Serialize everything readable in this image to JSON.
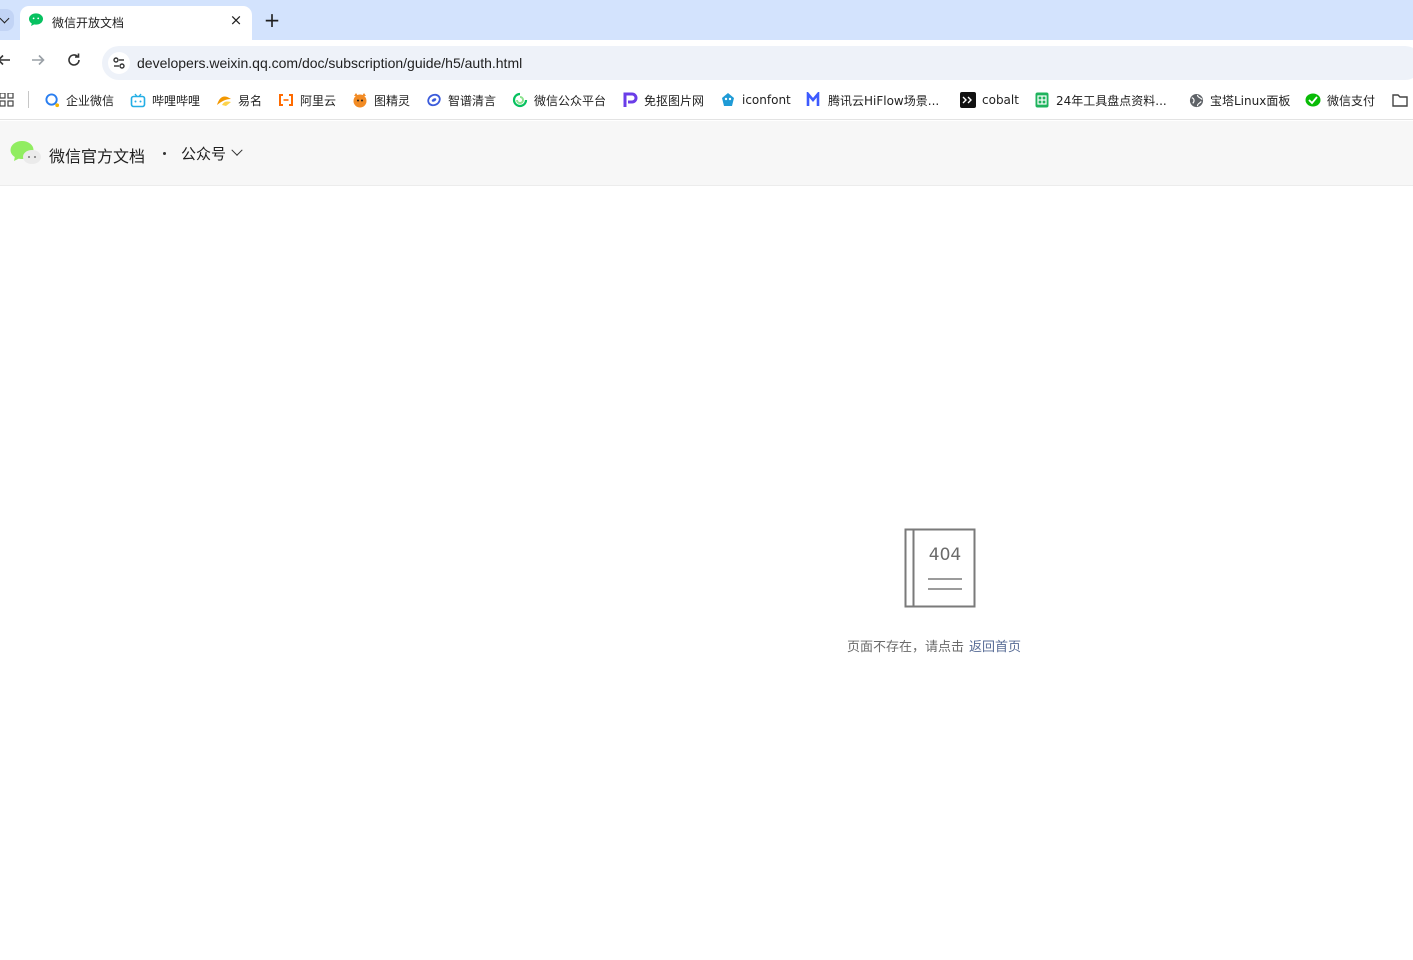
{
  "browser": {
    "tab": {
      "title": "微信开放文档",
      "close": "×"
    },
    "new_tab": "+",
    "url": "developers.weixin.qq.com/doc/subscription/guide/h5/auth.html"
  },
  "bookmarks": [
    {
      "label": "企业微信",
      "icon": "wecom-icon",
      "color": "#2a7ef0"
    },
    {
      "label": "哔哩哔哩",
      "icon": "bilibili-icon",
      "color": "#23aee5"
    },
    {
      "label": "易名",
      "icon": "ename-icon",
      "color": "#f39800"
    },
    {
      "label": "阿里云",
      "icon": "aliyun-icon",
      "color": "#ff6a00"
    },
    {
      "label": "图精灵",
      "icon": "tujingling-icon",
      "color": "#f28b24"
    },
    {
      "label": "智谱清言",
      "icon": "zhipu-icon",
      "color": "#3b5bdb"
    },
    {
      "label": "微信公众平台",
      "icon": "wechat-mp-icon",
      "color": "#07c160"
    },
    {
      "label": "免抠图片网",
      "icon": "mkpng-icon",
      "color": "#6a3de8"
    },
    {
      "label": "iconfont",
      "icon": "iconfont-icon",
      "color": "#1f9bd6"
    },
    {
      "label": "腾讯云HiFlow场景...",
      "icon": "hiflow-icon",
      "color": "#3d5afe"
    },
    {
      "label": "cobalt",
      "icon": "cobalt-icon",
      "color": "#111111"
    },
    {
      "label": "24年工具盘点资料...",
      "icon": "sheet-icon",
      "color": "#1fb35d"
    },
    {
      "label": "宝塔Linux面板",
      "icon": "globe-icon",
      "color": "#5f6368"
    },
    {
      "label": "微信支付",
      "icon": "wechat-pay-icon",
      "color": "#09bb07"
    }
  ],
  "header": {
    "site_title": "微信官方文档",
    "section": "公众号"
  },
  "error": {
    "code": "404",
    "message": "页面不存在，请点击",
    "link": "返回首页"
  }
}
